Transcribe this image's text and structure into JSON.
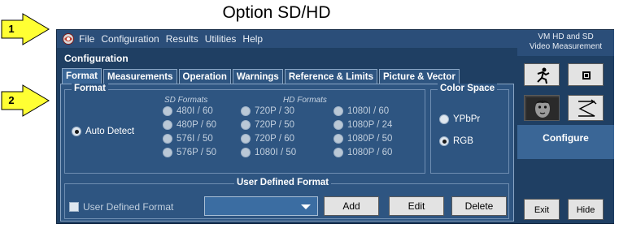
{
  "caption": "Option SD/HD",
  "callouts": [
    {
      "number": "1"
    },
    {
      "number": "2"
    }
  ],
  "menu": [
    "File",
    "Configuration",
    "Results",
    "Utilities",
    "Help"
  ],
  "configuration_title": "Configuration",
  "tabs": [
    {
      "label": "Format",
      "active": true
    },
    {
      "label": "Measurements",
      "active": false
    },
    {
      "label": "Operation",
      "active": false
    },
    {
      "label": "Warnings",
      "active": false
    },
    {
      "label": "Reference & Limits",
      "active": false
    },
    {
      "label": "Picture & Vector",
      "active": false
    }
  ],
  "format_group": {
    "title": "Format",
    "auto_detect": {
      "label": "Auto Detect",
      "selected": true
    },
    "sd_heading": "SD Formats",
    "hd_heading": "HD Formats",
    "sd_formats": [
      "480I / 60",
      "480P / 60",
      "576I / 50",
      "576P / 50"
    ],
    "hd_formats_col1": [
      "720P / 30",
      "720P / 50",
      "720P / 60",
      "1080I / 50"
    ],
    "hd_formats_col2": [
      "1080I / 60",
      "1080P / 24",
      "1080P / 50",
      "1080P / 60"
    ]
  },
  "color_space": {
    "title": "Color Space",
    "options": [
      {
        "label": "YPbPr",
        "selected": false
      },
      {
        "label": "RGB",
        "selected": true
      }
    ]
  },
  "user_defined": {
    "title": "User Defined Format",
    "checkbox_label": "User Defined Format",
    "checked": false,
    "dropdown_value": "",
    "buttons": {
      "add": "Add",
      "edit": "Edit",
      "delete": "Delete"
    }
  },
  "right_panel": {
    "title_line1": "VM HD and SD",
    "title_line2": "Video Measurement",
    "configure": "Configure",
    "exit": "Exit",
    "hide": "Hide"
  },
  "colors": {
    "window_bg": "#1f3f63",
    "panel_bg": "#2e5581",
    "callout_fill": "#ffff33",
    "button_face": "#e3e3e3"
  }
}
